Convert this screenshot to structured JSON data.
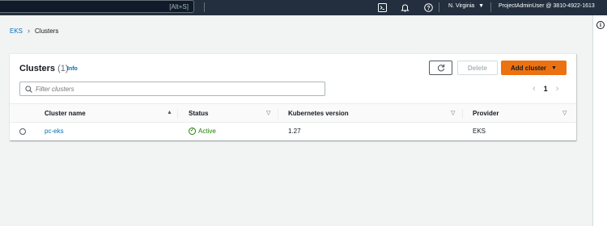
{
  "topbar": {
    "search_shortcut": "[Alt+S]",
    "region": "N. Virginia",
    "account": "ProjectAdminUser @ 3810-4922-1613"
  },
  "breadcrumb": {
    "root": "EKS",
    "current": "Clusters"
  },
  "panel": {
    "title": "Clusters",
    "count": "(1)",
    "info_link": "Info",
    "refresh_label": "",
    "delete_label": "Delete",
    "add_label": "Add cluster",
    "filter_placeholder": "Filter clusters",
    "page_number": "1"
  },
  "table": {
    "columns": [
      "Cluster name",
      "Status",
      "Kubernetes version",
      "Provider"
    ],
    "rows": [
      {
        "name": "pc-eks",
        "status": "Active",
        "version": "1.27",
        "provider": "EKS"
      }
    ]
  },
  "colors": {
    "topbar": "#232f3e",
    "link": "#0073bb",
    "primary_button": "#ec7211",
    "success": "#1d8102"
  },
  "icons": [
    "cloudshell-icon",
    "bell-icon",
    "help-icon",
    "refresh-icon",
    "search-icon",
    "info-icon",
    "check-circle-icon"
  ]
}
